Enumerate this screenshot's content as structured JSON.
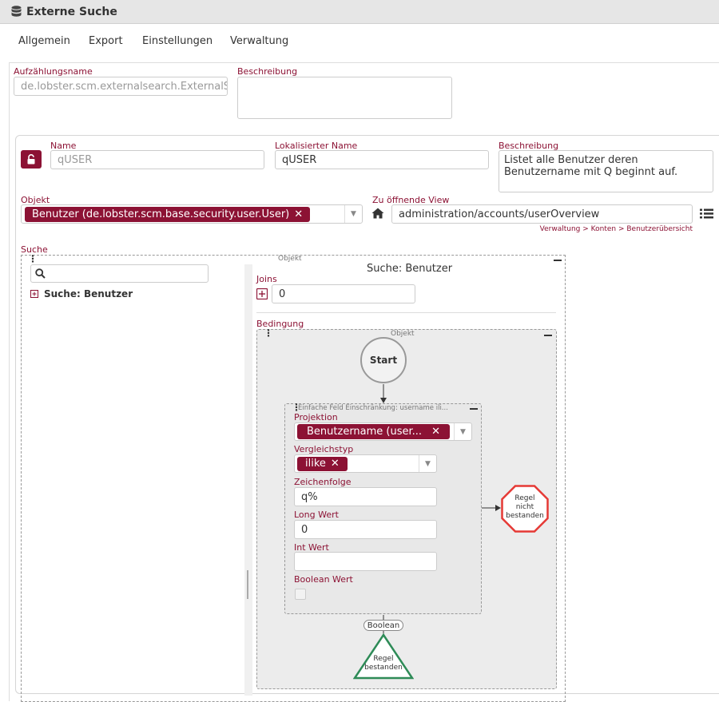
{
  "window": {
    "title": "Externe Suche",
    "icon": "database-icon"
  },
  "menu": [
    {
      "label": "Allgemein"
    },
    {
      "label": "Export"
    },
    {
      "label": "Einstellungen"
    },
    {
      "label": "Verwaltung"
    }
  ],
  "enum": {
    "name_label": "Aufzählungsname",
    "name_value": "de.lobster.scm.externalsearch.ExternalSea",
    "desc_label": "Beschreibung",
    "desc_value": ""
  },
  "search_def": {
    "lock_icon": "lock-open-icon",
    "name_label": "Name",
    "name_value": "qUSER",
    "loc_label": "Lokalisierter Name",
    "loc_value": "qUSER",
    "desc_label": "Beschreibung",
    "desc_value": "Listet alle Benutzer deren Benutzername mit Q beginnt auf.",
    "object_label": "Objekt",
    "object_tag": "Benutzer (de.lobster.scm.base.security.user.User)",
    "view_label": "Zu öffnende View",
    "view_value": "administration/accounts/userOverview",
    "view_path": "Verwaltung > Konten > Benutzerübersicht"
  },
  "suche": {
    "label": "Suche",
    "container_label": "Objekt",
    "tree_root": "Suche: Benutzer",
    "panel_title": "Suche: Benutzer",
    "joins_label": "Joins",
    "joins_value": "0",
    "bedingung_label": "Bedingung",
    "inner_label": "Objekt",
    "start_label": "Start",
    "rule": {
      "header": "Einfache Feld Einschränkung: username ili...",
      "projektion_label": "Projektion",
      "projektion_tag": "Benutzername (user...",
      "vergleich_label": "Vergleichstyp",
      "vergleich_tag": "ilike",
      "zeichen_label": "Zeichenfolge",
      "zeichen_value": "q%",
      "long_label": "Long Wert",
      "long_value": "0",
      "int_label": "Int Wert",
      "int_value": "",
      "bool_label": "Boolean Wert",
      "bool_checked": false
    },
    "fail_label": "Regel nicht bestanden",
    "edge_label": "Boolean",
    "pass_label": "Regel bestanden"
  },
  "colors": {
    "accent": "#8c1234",
    "fail": "#e53935",
    "pass": "#2e8b57",
    "header_bg": "#e6e6e6"
  }
}
